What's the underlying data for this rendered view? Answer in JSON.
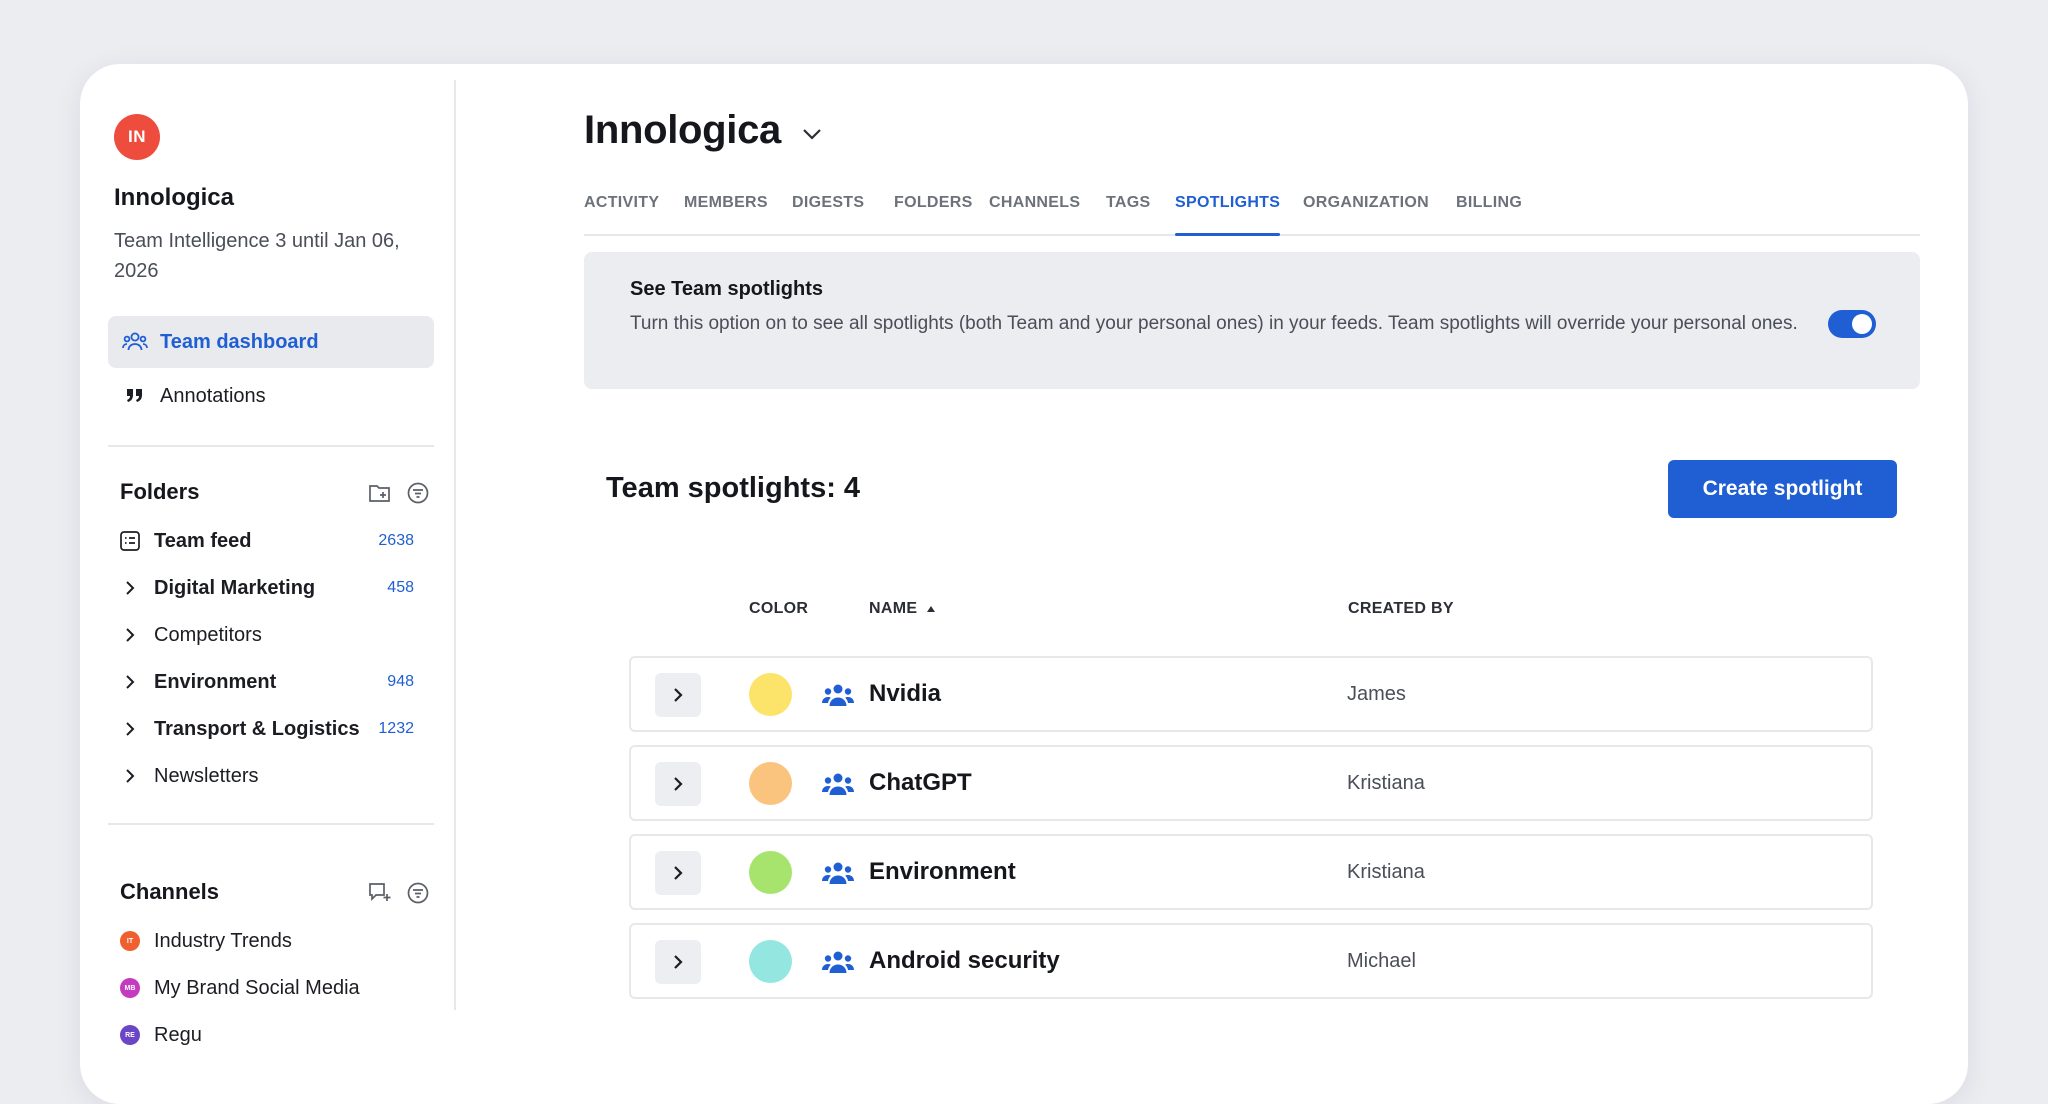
{
  "org": {
    "avatar_initials": "IN",
    "avatar_color": "#ee4d3e",
    "name": "Innologica",
    "plan": "Team Intelligence 3 until Jan 06, 2026"
  },
  "sidebar": {
    "nav": [
      {
        "label": "Team dashboard",
        "icon": "team-icon",
        "active": true
      },
      {
        "label": "Annotations",
        "icon": "quote-icon",
        "active": false
      }
    ],
    "folders_heading": "Folders",
    "folders": [
      {
        "label": "Team feed",
        "count": "2638",
        "bold": true,
        "icon": "feed-icon"
      },
      {
        "label": "Digital Marketing",
        "count": "458",
        "bold": true,
        "icon": "chevron-right-icon"
      },
      {
        "label": "Competitors",
        "count": "",
        "bold": false,
        "icon": "chevron-right-icon"
      },
      {
        "label": "Environment",
        "count": "948",
        "bold": true,
        "icon": "chevron-right-icon"
      },
      {
        "label": "Transport & Logistics",
        "count": "1232",
        "bold": true,
        "icon": "chevron-right-icon"
      },
      {
        "label": "Newsletters",
        "count": "",
        "bold": false,
        "icon": "chevron-right-icon"
      }
    ],
    "channels_heading": "Channels",
    "channels": [
      {
        "label": "Industry Trends",
        "initials": "IT",
        "color": "#f0602e"
      },
      {
        "label": "My Brand Social Media",
        "initials": "MB",
        "color": "#c43bc0"
      },
      {
        "label": "Regu",
        "initials": "RE",
        "color": "#6a45c6"
      }
    ]
  },
  "main": {
    "title": "Innologica",
    "tabs": [
      {
        "label": "ACTIVITY",
        "active": false
      },
      {
        "label": "MEMBERS",
        "active": false
      },
      {
        "label": "DIGESTS",
        "active": false
      },
      {
        "label": "FOLDERS",
        "active": false
      },
      {
        "label": "CHANNELS",
        "active": false
      },
      {
        "label": "TAGS",
        "active": false
      },
      {
        "label": "SPOTLIGHTS",
        "active": true
      },
      {
        "label": "ORGANIZATION",
        "active": false
      },
      {
        "label": "BILLING",
        "active": false
      }
    ],
    "banner": {
      "title": "See Team spotlights",
      "description": "Turn this option on to see all spotlights (both Team and your personal ones) in your feeds. Team spotlights will override your personal ones.",
      "toggle_on": true
    },
    "spotlights_count_title": "Team spotlights: 4",
    "create_button": "Create spotlight",
    "columns": {
      "color": "COLOR",
      "name": "NAME",
      "created_by": "CREATED BY"
    },
    "spotlights": [
      {
        "name": "Nvidia",
        "color": "#fce36a",
        "created_by": "James"
      },
      {
        "name": "ChatGPT",
        "color": "#fac47f",
        "created_by": "Kristiana"
      },
      {
        "name": "Environment",
        "color": "#a6e46e",
        "created_by": "Kristiana"
      },
      {
        "name": "Android security",
        "color": "#94e6e0",
        "created_by": "Michael"
      }
    ]
  }
}
